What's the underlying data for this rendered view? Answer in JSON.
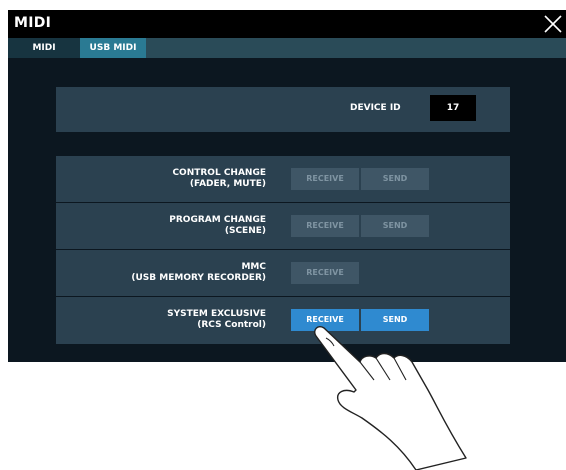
{
  "window": {
    "title": "MIDI"
  },
  "tabs": [
    {
      "label": "MIDI",
      "active": false
    },
    {
      "label": "USB MIDI",
      "active": true
    }
  ],
  "device": {
    "label": "DEVICE ID",
    "value": "17"
  },
  "rows": [
    {
      "label_line1": "CONTROL CHANGE",
      "label_line2": "(FADER, MUTE)",
      "receive": "RECEIVE",
      "send": "SEND",
      "receive_on": false,
      "send_on": false
    },
    {
      "label_line1": "PROGRAM CHANGE",
      "label_line2": "(SCENE)",
      "receive": "RECEIVE",
      "send": "SEND",
      "receive_on": false,
      "send_on": false
    },
    {
      "label_line1": "MMC",
      "label_line2": "(USB MEMORY RECORDER)",
      "receive": "RECEIVE",
      "receive_on": false
    },
    {
      "label_line1": "SYSTEM EXCLUSIVE",
      "label_line2": "(RCS Control)",
      "receive": "RECEIVE",
      "send": "SEND",
      "receive_on": true,
      "send_on": true
    }
  ],
  "colors": {
    "active_button": "#2f8ad0",
    "inactive_button": "#3f5666",
    "panel": "#2b4150",
    "tab_active": "#2a7a93"
  },
  "overlay": {
    "icon": "pointing-hand-icon"
  }
}
